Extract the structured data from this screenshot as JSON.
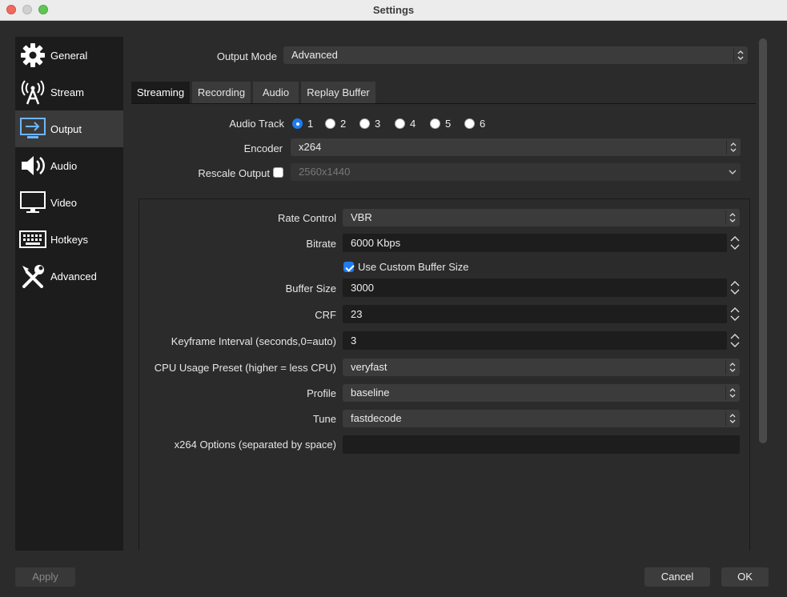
{
  "window": {
    "title": "Settings"
  },
  "sidebar": {
    "items": [
      {
        "label": "General",
        "icon": "gear-icon"
      },
      {
        "label": "Stream",
        "icon": "antenna-icon"
      },
      {
        "label": "Output",
        "icon": "output-icon",
        "active": true
      },
      {
        "label": "Audio",
        "icon": "speaker-icon"
      },
      {
        "label": "Video",
        "icon": "monitor-icon"
      },
      {
        "label": "Hotkeys",
        "icon": "keyboard-icon"
      },
      {
        "label": "Advanced",
        "icon": "tools-icon"
      }
    ]
  },
  "output_mode": {
    "label": "Output Mode",
    "value": "Advanced"
  },
  "tabs": [
    {
      "label": "Streaming",
      "active": true
    },
    {
      "label": "Recording"
    },
    {
      "label": "Audio"
    },
    {
      "label": "Replay Buffer"
    }
  ],
  "streaming": {
    "audio_track": {
      "label": "Audio Track",
      "options": [
        "1",
        "2",
        "3",
        "4",
        "5",
        "6"
      ],
      "selected": "1"
    },
    "encoder": {
      "label": "Encoder",
      "value": "x264"
    },
    "rescale_output": {
      "label": "Rescale Output",
      "checked": false,
      "value": "2560x1440"
    },
    "encoder_settings": {
      "rate_control": {
        "label": "Rate Control",
        "value": "VBR"
      },
      "bitrate": {
        "label": "Bitrate",
        "value": "6000 Kbps"
      },
      "custom_buffer": {
        "label": "Use Custom Buffer Size",
        "checked": true
      },
      "buffer_size": {
        "label": "Buffer Size",
        "value": "3000"
      },
      "crf": {
        "label": "CRF",
        "value": "23"
      },
      "keyframe": {
        "label": "Keyframe Interval (seconds,0=auto)",
        "value": "3"
      },
      "cpu_preset": {
        "label": "CPU Usage Preset (higher = less CPU)",
        "value": "veryfast"
      },
      "profile": {
        "label": "Profile",
        "value": "baseline"
      },
      "tune": {
        "label": "Tune",
        "value": "fastdecode"
      },
      "x264_options": {
        "label": "x264 Options (separated by space)",
        "value": ""
      }
    }
  },
  "buttons": {
    "apply": "Apply",
    "cancel": "Cancel",
    "ok": "OK"
  }
}
